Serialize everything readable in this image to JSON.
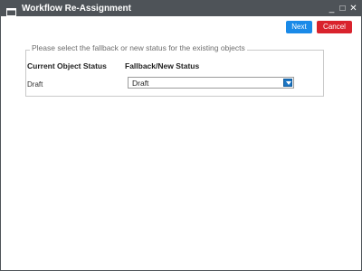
{
  "window": {
    "title": "Workflow Re-Assignment",
    "controls": {
      "minimize": "_",
      "maximize": "□",
      "close": "✕"
    }
  },
  "toolbar": {
    "next_label": "Next",
    "cancel_label": "Cancel"
  },
  "group": {
    "legend": "Please select the fallback or new status for the existing objects",
    "columns": [
      "Current Object Status",
      "Fallback/New Status"
    ],
    "rows": [
      {
        "current_status": "Draft",
        "fallback_status": "Draft"
      }
    ]
  },
  "colors": {
    "titlebar": "#4e5358",
    "next_button": "#1a8ae8",
    "cancel_button": "#d9232d",
    "dropdown_arrow": "#1c76c4"
  },
  "icons": {
    "window_icon": "window-icon",
    "dropdown_icon": "chevron-down-icon"
  }
}
